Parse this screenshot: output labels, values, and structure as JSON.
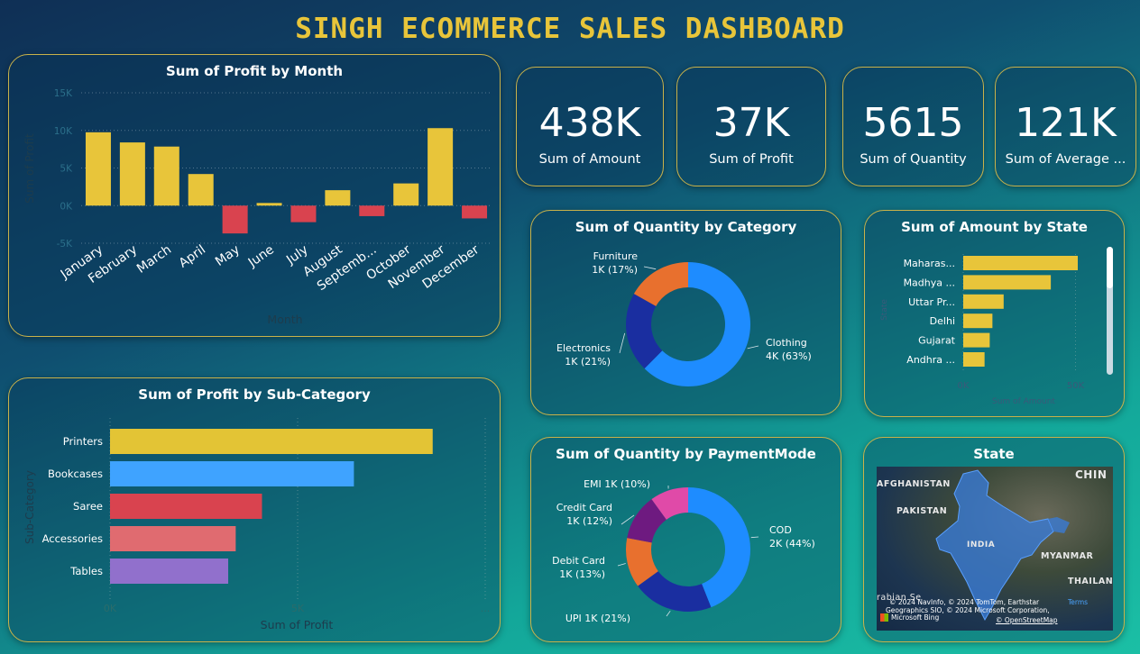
{
  "header": {
    "title": "SINGH ECOMMERCE SALES DASHBOARD"
  },
  "colors": {
    "accent": "#e8c53a",
    "negative": "#d9434f",
    "border": "#c9b24a"
  },
  "kpis": [
    {
      "value": "438K",
      "label": "Sum of Amount"
    },
    {
      "value": "37K",
      "label": "Sum of Profit"
    },
    {
      "value": "5615",
      "label": "Sum of Quantity"
    },
    {
      "value": "121K",
      "label": "Sum of Average ..."
    }
  ],
  "map": {
    "title": "State",
    "labels": [
      "AFGHANISTAN",
      "PAKISTAN",
      "CHIN",
      "INDIA",
      "MYANMAR",
      "THAILAN",
      "rabian Se"
    ],
    "credits": [
      "© 2024 NavInfo, © 2024 TomTom, Earthstar",
      "Geographics SIO, © 2024 Microsoft Corporation,",
      "© OpenStreetMap"
    ],
    "terms": "Terms",
    "brand": "Microsoft Bing"
  },
  "chart_data": [
    {
      "type": "bar",
      "title": "Sum of Profit by Month",
      "xlabel": "Month",
      "ylabel": "Sum of Profit",
      "categories": [
        "January",
        "February",
        "March",
        "April",
        "May",
        "June",
        "July",
        "August",
        "Septemb...",
        "October",
        "November",
        "December"
      ],
      "values": [
        9750,
        8400,
        7850,
        4200,
        -3700,
        350,
        -2200,
        2050,
        -1400,
        2950,
        10300,
        -1700
      ],
      "ylim": [
        -5000,
        15000
      ],
      "yticks": [
        "-5K",
        "0K",
        "5K",
        "10K",
        "15K"
      ],
      "grid": true
    },
    {
      "type": "bar",
      "orientation": "horizontal",
      "title": "Sum of Profit by Sub-Category",
      "xlabel": "Sum of Profit",
      "ylabel": "Sub-Category",
      "categories": [
        "Printers",
        "Bookcases",
        "Saree",
        "Accessories",
        "Tables"
      ],
      "values": [
        8600,
        6500,
        4050,
        3350,
        3150
      ],
      "colors": [
        "#e3c435",
        "#3fa3ff",
        "#d9434f",
        "#e06b70",
        "#9170cc"
      ],
      "xlim": [
        0,
        10000
      ],
      "xticks": [
        "0K",
        "5K"
      ],
      "xtick_more": "..."
    },
    {
      "type": "pie",
      "title": "Sum of Quantity by Category",
      "slices": [
        {
          "name": "Clothing",
          "label": "4K (63%)",
          "pct": 63,
          "color": "#1e8cff"
        },
        {
          "name": "Electronics",
          "label": "1K (21%)",
          "pct": 21,
          "color": "#1a2ea0"
        },
        {
          "name": "Furniture",
          "label": "1K (17%)",
          "pct": 17,
          "color": "#e8702e"
        }
      ]
    },
    {
      "type": "bar",
      "orientation": "horizontal",
      "title": "Sum of Amount by State",
      "xlabel": "Sum of Amount",
      "ylabel": "State",
      "categories": [
        "Maharas...",
        "Madhya ...",
        "Uttar Pr...",
        "Delhi",
        "Gujarat",
        "Andhra ..."
      ],
      "values": [
        51000,
        39000,
        18000,
        13000,
        11800,
        9500
      ],
      "xlim": [
        0,
        51000
      ],
      "xticks": [
        "0K",
        "50K"
      ]
    },
    {
      "type": "pie",
      "title": "Sum of Quantity by PaymentMode",
      "slices": [
        {
          "name": "COD",
          "label": "2K (44%)",
          "pct": 44,
          "color": "#1e8cff"
        },
        {
          "name": "UPI",
          "label": "1K (21%)",
          "pct": 21,
          "color": "#1a2ea0"
        },
        {
          "name": "Debit Card",
          "label": "1K (13%)",
          "pct": 13,
          "color": "#e8702e"
        },
        {
          "name": "Credit Card",
          "label": "1K (12%)",
          "pct": 12,
          "color": "#6e1a80"
        },
        {
          "name": "EMI",
          "label": "1K (10%)",
          "pct": 10,
          "color": "#e04aa8"
        }
      ]
    }
  ]
}
